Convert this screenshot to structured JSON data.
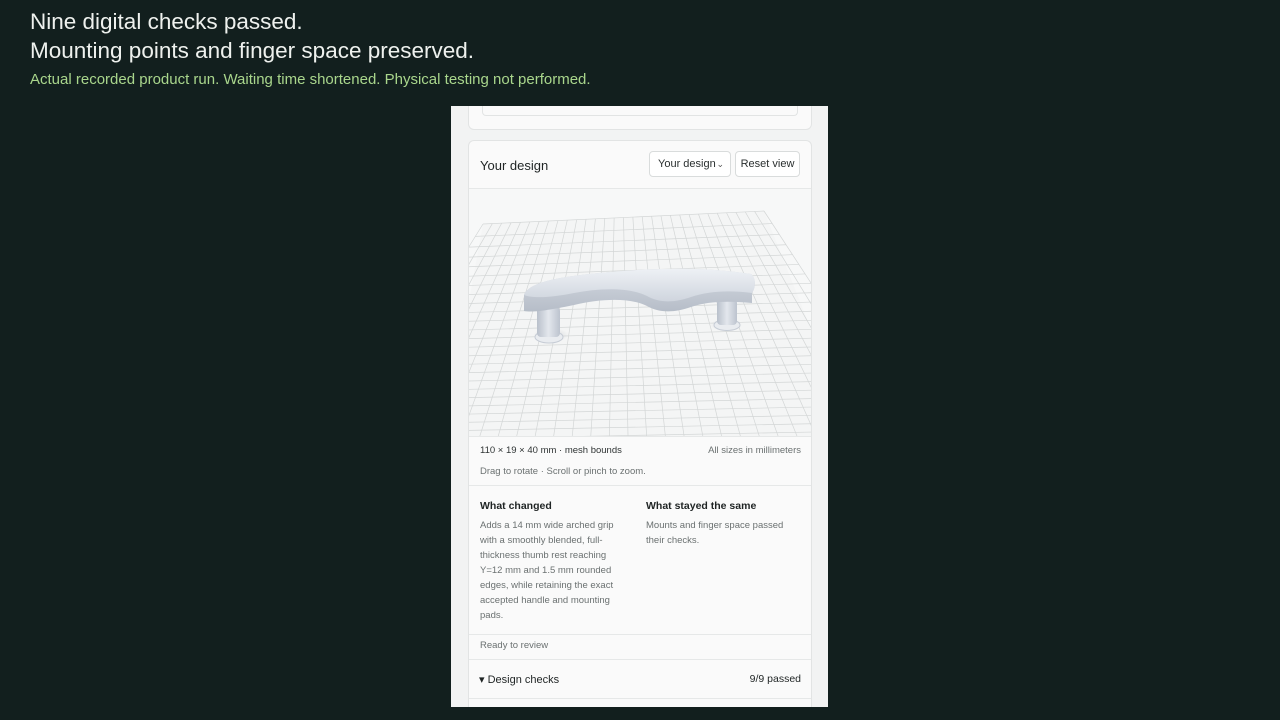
{
  "caption": {
    "line1": "Nine digital checks passed.",
    "line2": "Mounting points and finger space preserved.",
    "subline": "Actual recorded product run. Waiting time shortened. Physical testing not performed."
  },
  "panel": {
    "title": "Your design",
    "view_select": {
      "value": "Your design",
      "icon": "chevron-down-icon"
    },
    "reset_label": "Reset view",
    "viewer": {
      "bounds": "110 × 19 × 40 mm · mesh bounds",
      "units": "All sizes in millimeters",
      "hint": "Drag to rotate · Scroll or pinch to zoom."
    },
    "what_changed": {
      "heading": "What changed",
      "body": "Adds a 14 mm wide arched grip with a smoothly blended, full-thickness thumb rest reaching Y=12 mm and 1.5 mm rounded edges, while retaining the exact accepted handle and mounting pads."
    },
    "what_stayed": {
      "heading": "What stayed the same",
      "body": "Mounts and finger space passed their checks."
    },
    "status": "Ready to review",
    "design_checks": {
      "label": "▾ Design checks",
      "count": "9/9 passed"
    }
  },
  "colors": {
    "background": "#121f1e",
    "caption_text": "#eef1ee",
    "caption_accent": "#a9d68c",
    "model": "#d9dee6"
  }
}
